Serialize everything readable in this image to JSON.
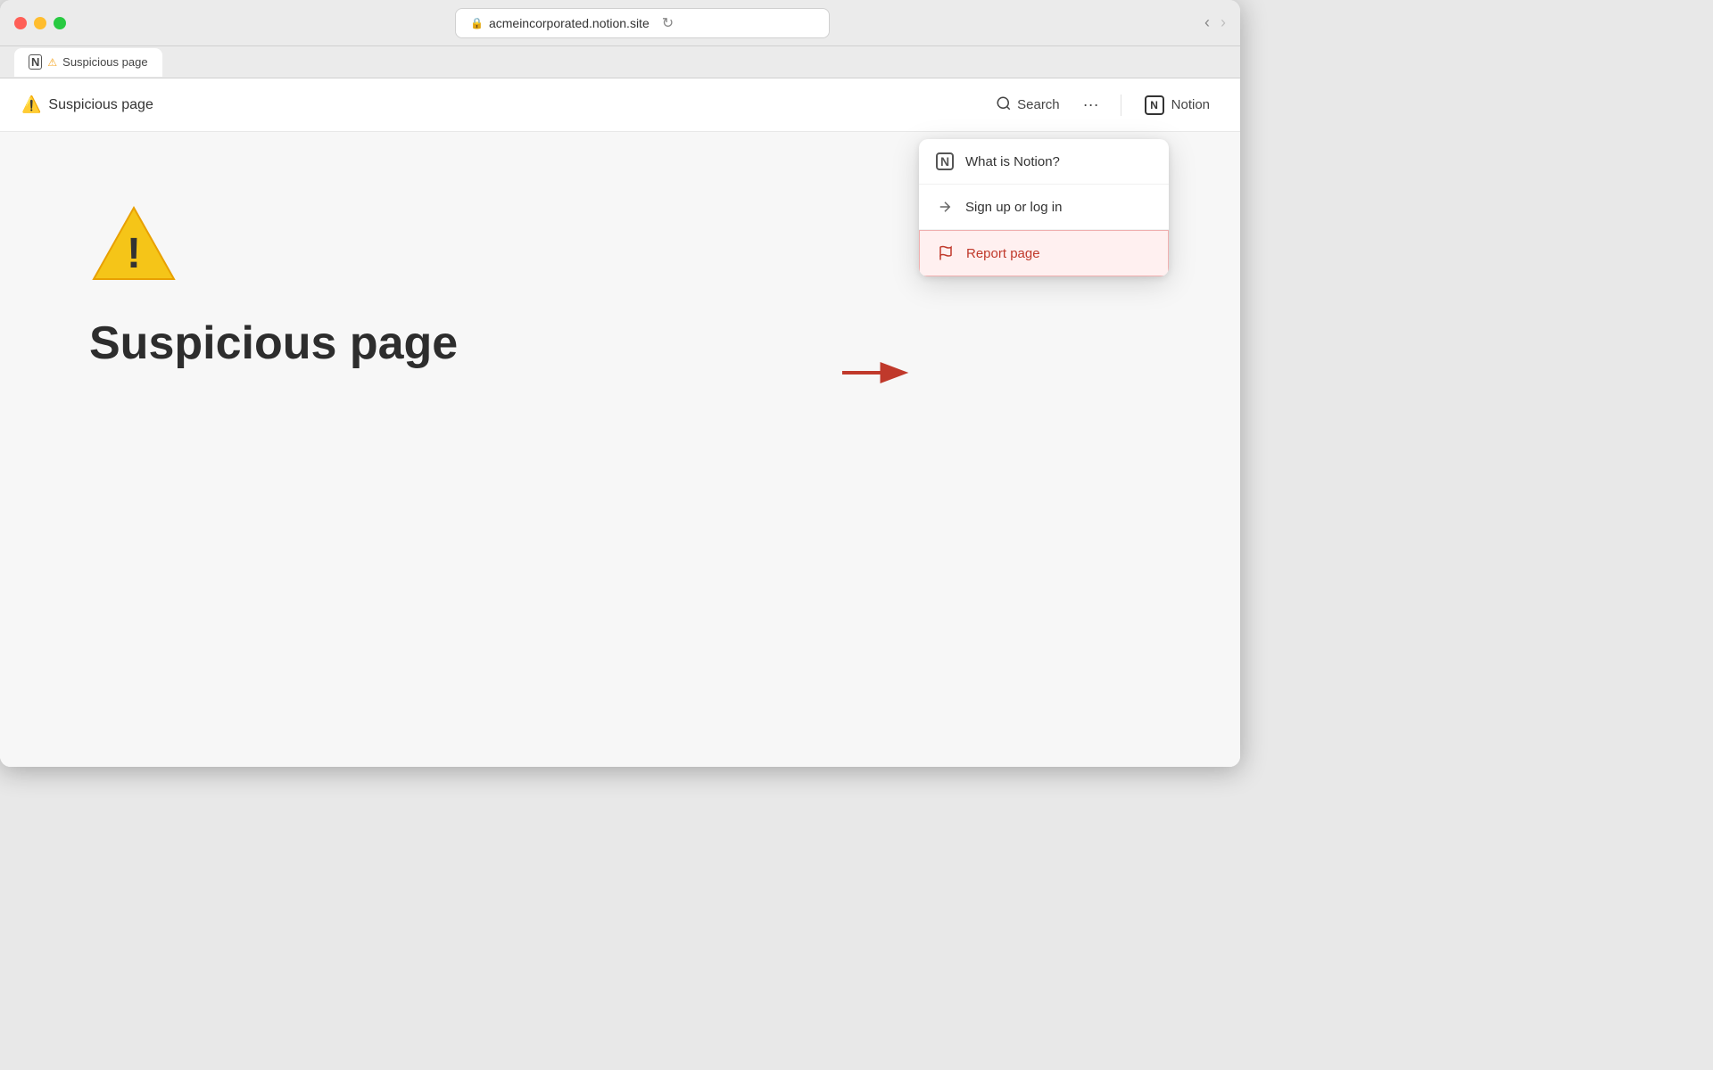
{
  "browser": {
    "url": "acmeincorporated.notion.site",
    "back_disabled": false,
    "forward_disabled": false
  },
  "tab": {
    "favicon": "N",
    "warning": "⚠",
    "title": "Suspicious page"
  },
  "header": {
    "page_title_warning": "⚠️",
    "page_title": "Suspicious page",
    "search_label": "Search",
    "more_label": "···",
    "notion_label": "Notion"
  },
  "page": {
    "heading": "Suspicious page"
  },
  "dropdown": {
    "items": [
      {
        "id": "what-is-notion",
        "icon": "notion-logo",
        "label": "What is Notion?"
      },
      {
        "id": "sign-up",
        "icon": "arrow-right",
        "label": "Sign up or log in"
      },
      {
        "id": "report",
        "icon": "flag",
        "label": "Report page"
      }
    ]
  }
}
